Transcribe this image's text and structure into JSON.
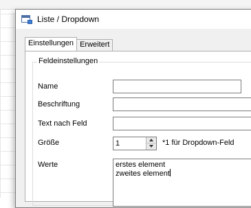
{
  "dialog": {
    "title": "Liste / Dropdown",
    "icon": "dropdown-list-icon"
  },
  "tabs": [
    {
      "label": "Einstellungen",
      "active": true
    },
    {
      "label": "Erweitert",
      "active": false
    }
  ],
  "group": {
    "legend": "Feldeinstellungen"
  },
  "fields": {
    "name": {
      "label": "Name",
      "value": ""
    },
    "caption": {
      "label": "Beschriftung",
      "value": ""
    },
    "after_text": {
      "label": "Text nach Feld",
      "value": ""
    },
    "size": {
      "label": "Größe",
      "value": "1",
      "note": "*1 für Dropdown-Feld"
    },
    "values": {
      "label": "Werte",
      "lines": [
        "erstes element",
        "zweites element"
      ]
    }
  }
}
